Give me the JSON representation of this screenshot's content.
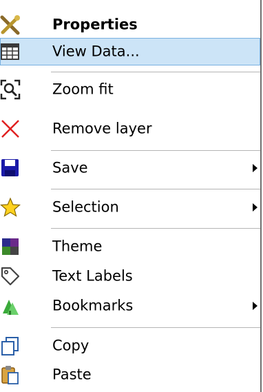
{
  "menu": {
    "items": [
      {
        "label": "Properties",
        "icon": "tools-icon"
      },
      {
        "label": "View Data...",
        "icon": "table-icon"
      },
      {
        "label": "Zoom fit",
        "icon": "zoom-fit-icon"
      },
      {
        "label": "Remove layer",
        "icon": "remove-x-icon"
      },
      {
        "label": "Save",
        "icon": "floppy-disk-icon"
      },
      {
        "label": "Selection",
        "icon": "star-icon"
      },
      {
        "label": "Theme",
        "icon": "theme-palette-icon"
      },
      {
        "label": "Text Labels",
        "icon": "tag-icon"
      },
      {
        "label": "Bookmarks",
        "icon": "bookmark-tree-icon"
      },
      {
        "label": "Copy",
        "icon": "copy-icon"
      },
      {
        "label": "Paste",
        "icon": "paste-icon"
      }
    ]
  },
  "colors": {
    "highlight": "#cce4f7",
    "highlight_border": "#78b0e0",
    "separator": "#b4b4b4",
    "remove_x": "#e02020",
    "star": "#ffd21f",
    "save_blue": "#1a1aa8"
  }
}
